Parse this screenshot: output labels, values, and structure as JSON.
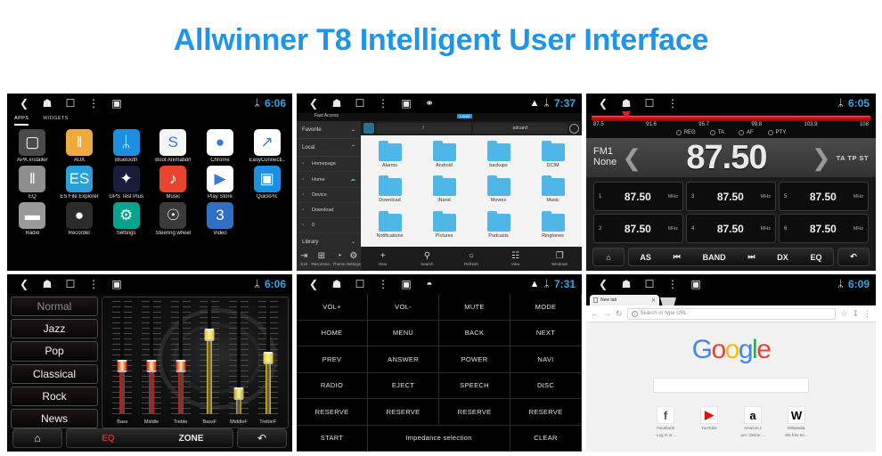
{
  "title": "Allwinner T8 Intelligent User Interface",
  "app_drawer": {
    "status_time": "6:06",
    "tabs": [
      {
        "label": "APPS",
        "selected": true
      },
      {
        "label": "WIDGETS",
        "selected": false
      }
    ],
    "apps": [
      {
        "label": "APK installer",
        "icon": "android-robot-icon",
        "bg": "#4a4a4a",
        "glyph": "▢"
      },
      {
        "label": "AUX",
        "icon": "aux-sliders-icon",
        "bg": "#f0a93c",
        "glyph": "‖"
      },
      {
        "label": "Bluetooth",
        "icon": "bluetooth-icon",
        "bg": "#1d8fe0",
        "glyph": "ᛦ"
      },
      {
        "label": "Boot Animation",
        "icon": "boot-animation-icon",
        "bg": "#f5f5f5",
        "glyph": "S"
      },
      {
        "label": "Chrome",
        "icon": "chrome-icon",
        "bg": "#ffffff",
        "glyph": "●"
      },
      {
        "label": "EasyConnecti..",
        "icon": "easyconnected-icon",
        "bg": "#ffffff",
        "glyph": "↗"
      },
      {
        "label": "EQ",
        "icon": "equalizer-icon",
        "bg": "#8e8e8e",
        "glyph": "‖"
      },
      {
        "label": "ES File Explorer",
        "icon": "es-file-explorer-icon",
        "bg": "#2a9fd8",
        "glyph": "ES"
      },
      {
        "label": "GPS Test Plus",
        "icon": "gps-test-plus-icon",
        "bg": "#1b1b3a",
        "glyph": "✦"
      },
      {
        "label": "Music",
        "icon": "music-icon",
        "bg": "#e8452c",
        "glyph": "♪"
      },
      {
        "label": "Play Store",
        "icon": "play-store-icon",
        "bg": "#ffffff",
        "glyph": "▶"
      },
      {
        "label": "QuickPic",
        "icon": "quickpic-icon",
        "bg": "#1d8fe0",
        "glyph": "▣"
      },
      {
        "label": "Radio",
        "icon": "radio-icon",
        "bg": "#9a9a9a",
        "glyph": "▬"
      },
      {
        "label": "Recorder",
        "icon": "recorder-icon",
        "bg": "#2b2b2b",
        "glyph": "●"
      },
      {
        "label": "Settings",
        "icon": "settings-gear-icon",
        "bg": "#00a38c",
        "glyph": "⚙"
      },
      {
        "label": "Steering wheel",
        "icon": "steering-wheel-icon",
        "bg": "#3a3a3a",
        "glyph": "☉"
      },
      {
        "label": "Video",
        "icon": "video-icon",
        "bg": "#2f6fc4",
        "glyph": "3"
      }
    ]
  },
  "file_explorer": {
    "status_time": "7:37",
    "fast_access_label": "Fast Access",
    "local_tab": "Local",
    "sidebar": [
      {
        "label": "Favorite",
        "type": "group",
        "chevron": "⌄"
      },
      {
        "label": "Local",
        "type": "group",
        "chevron": "⌃"
      },
      {
        "label": "Homepage",
        "type": "item",
        "icon": "home-outline-icon"
      },
      {
        "label": "Home",
        "type": "item",
        "icon": "folder-icon",
        "badge": "cloud-icon"
      },
      {
        "label": "Device",
        "type": "item",
        "icon": "slash-icon"
      },
      {
        "label": "Download",
        "type": "item",
        "icon": "download-icon"
      },
      {
        "label": "0",
        "type": "item",
        "icon": "sdcard-icon"
      },
      {
        "label": "Library",
        "type": "group",
        "chevron": "⌄"
      }
    ],
    "path": [
      "/",
      "sdcard"
    ],
    "folders": [
      "Alarms",
      "Android",
      "backups",
      "DCIM",
      "Download",
      "iNand",
      "Movies",
      "Music",
      "Notifications",
      "Pictures",
      "Podcasts",
      "Ringtones"
    ],
    "side_toolbar": [
      {
        "label": "Exit",
        "icon": "exit-icon",
        "glyph": "⇥"
      },
      {
        "label": "Recomme..",
        "icon": "recommend-icon",
        "glyph": "⊞"
      },
      {
        "label": "Theme",
        "icon": "theme-icon",
        "glyph": "◔"
      },
      {
        "label": "Settings",
        "icon": "settings-icon",
        "glyph": "⚙"
      }
    ],
    "toolbar": [
      {
        "label": "New",
        "icon": "plus-icon",
        "glyph": "+"
      },
      {
        "label": "Search",
        "icon": "search-icon",
        "glyph": "⚲"
      },
      {
        "label": "Refresh",
        "icon": "refresh-icon",
        "glyph": "○"
      },
      {
        "label": "View",
        "icon": "grid-view-icon",
        "glyph": "☷"
      },
      {
        "label": "Windows",
        "icon": "windows-icon",
        "glyph": "❐"
      }
    ]
  },
  "radio": {
    "status_time": "6:05",
    "scale_ticks": [
      "87.5",
      "91.6",
      "95.7",
      "99.8",
      "103.9",
      "108"
    ],
    "flags": [
      "REG",
      "TA",
      "AF",
      "PTY"
    ],
    "band": "FM1",
    "station_name": "None",
    "frequency": "87.50",
    "indicators": "TA TP ST",
    "presets": [
      {
        "num": "1",
        "freq": "87.50",
        "unit": "MHz"
      },
      {
        "num": "3",
        "freq": "87.50",
        "unit": "MHz"
      },
      {
        "num": "5",
        "freq": "87.50",
        "unit": "MHz"
      },
      {
        "num": "2",
        "freq": "87.50",
        "unit": "MHz"
      },
      {
        "num": "4",
        "freq": "87.50",
        "unit": "MHz"
      },
      {
        "num": "6",
        "freq": "87.50",
        "unit": "MHz"
      }
    ],
    "home_glyph": "⌂",
    "back_glyph": "↶",
    "controls": [
      "AS",
      "⏮",
      "BAND",
      "⏭",
      "DX",
      "EQ"
    ]
  },
  "equalizer": {
    "status_time": "6:06",
    "presets": [
      {
        "label": "Normal",
        "active": false
      },
      {
        "label": "Jazz",
        "active": true
      },
      {
        "label": "Pop",
        "active": true
      },
      {
        "label": "Classical",
        "active": true
      },
      {
        "label": "Rock",
        "active": true
      },
      {
        "label": "News",
        "active": true
      }
    ],
    "sliders": [
      {
        "label": "Bass",
        "color": "#d81414",
        "value": 38
      },
      {
        "label": "Middle",
        "color": "#d81414",
        "value": 38
      },
      {
        "label": "Treble",
        "color": "#d81414",
        "value": 38
      },
      {
        "label": "BassF",
        "color": "#e8c018",
        "value": 62
      },
      {
        "label": "MiddleF",
        "color": "#c9a42a",
        "value": 16
      },
      {
        "label": "TrebleF",
        "color": "#e8c018",
        "value": 44
      }
    ],
    "home_glyph": "⌂",
    "back_glyph": "↶",
    "eq_label": "EQ",
    "zone_label": "ZONE",
    "eq_color": "#d02a2a"
  },
  "steering_wheel": {
    "status_time": "7:31",
    "buttons": [
      {
        "label": "VOL+",
        "span": 1
      },
      {
        "label": "VOL-",
        "span": 1
      },
      {
        "label": "MUTE",
        "span": 1
      },
      {
        "label": "MODE",
        "span": 1
      },
      {
        "label": "HOME",
        "span": 1
      },
      {
        "label": "MENU",
        "span": 1
      },
      {
        "label": "BACK",
        "span": 1
      },
      {
        "label": "NEXT",
        "span": 1
      },
      {
        "label": "PREV",
        "span": 1
      },
      {
        "label": "ANSWER",
        "span": 1
      },
      {
        "label": "POWER",
        "span": 1
      },
      {
        "label": "NAVI",
        "span": 1
      },
      {
        "label": "RADIO",
        "span": 1
      },
      {
        "label": "EJECT",
        "span": 1
      },
      {
        "label": "SPEECH",
        "span": 1
      },
      {
        "label": "DISC",
        "span": 1
      },
      {
        "label": "RESERVE",
        "span": 1
      },
      {
        "label": "RESERVE",
        "span": 1
      },
      {
        "label": "RESERVE",
        "span": 1
      },
      {
        "label": "RESERVE",
        "span": 1
      },
      {
        "label": "START",
        "span": 1
      },
      {
        "label": "Impedance selection",
        "span": 2
      },
      {
        "label": "CLEAR",
        "span": 1
      }
    ]
  },
  "browser": {
    "status_time": "6:09",
    "tab_title": "New tab",
    "url_placeholder": "Search or type URL",
    "logo": {
      "g1": "G",
      "o1": "o",
      "o2": "o",
      "g2": "g",
      "l": "l",
      "e": "e"
    },
    "shortcuts": [
      {
        "glyph": "f",
        "color": "#3b5998",
        "name": "Facebook",
        "desc": "- Log In or ..."
      },
      {
        "glyph": "▶",
        "color": "#ff0000",
        "name": "YouTube",
        "desc": ""
      },
      {
        "glyph": "a",
        "color": "#000000",
        "name": "Amazon.c",
        "desc": "om: Online ..."
      },
      {
        "glyph": "W",
        "color": "#000000",
        "name": "Wikipedia,",
        "desc": "the free en..."
      }
    ]
  }
}
